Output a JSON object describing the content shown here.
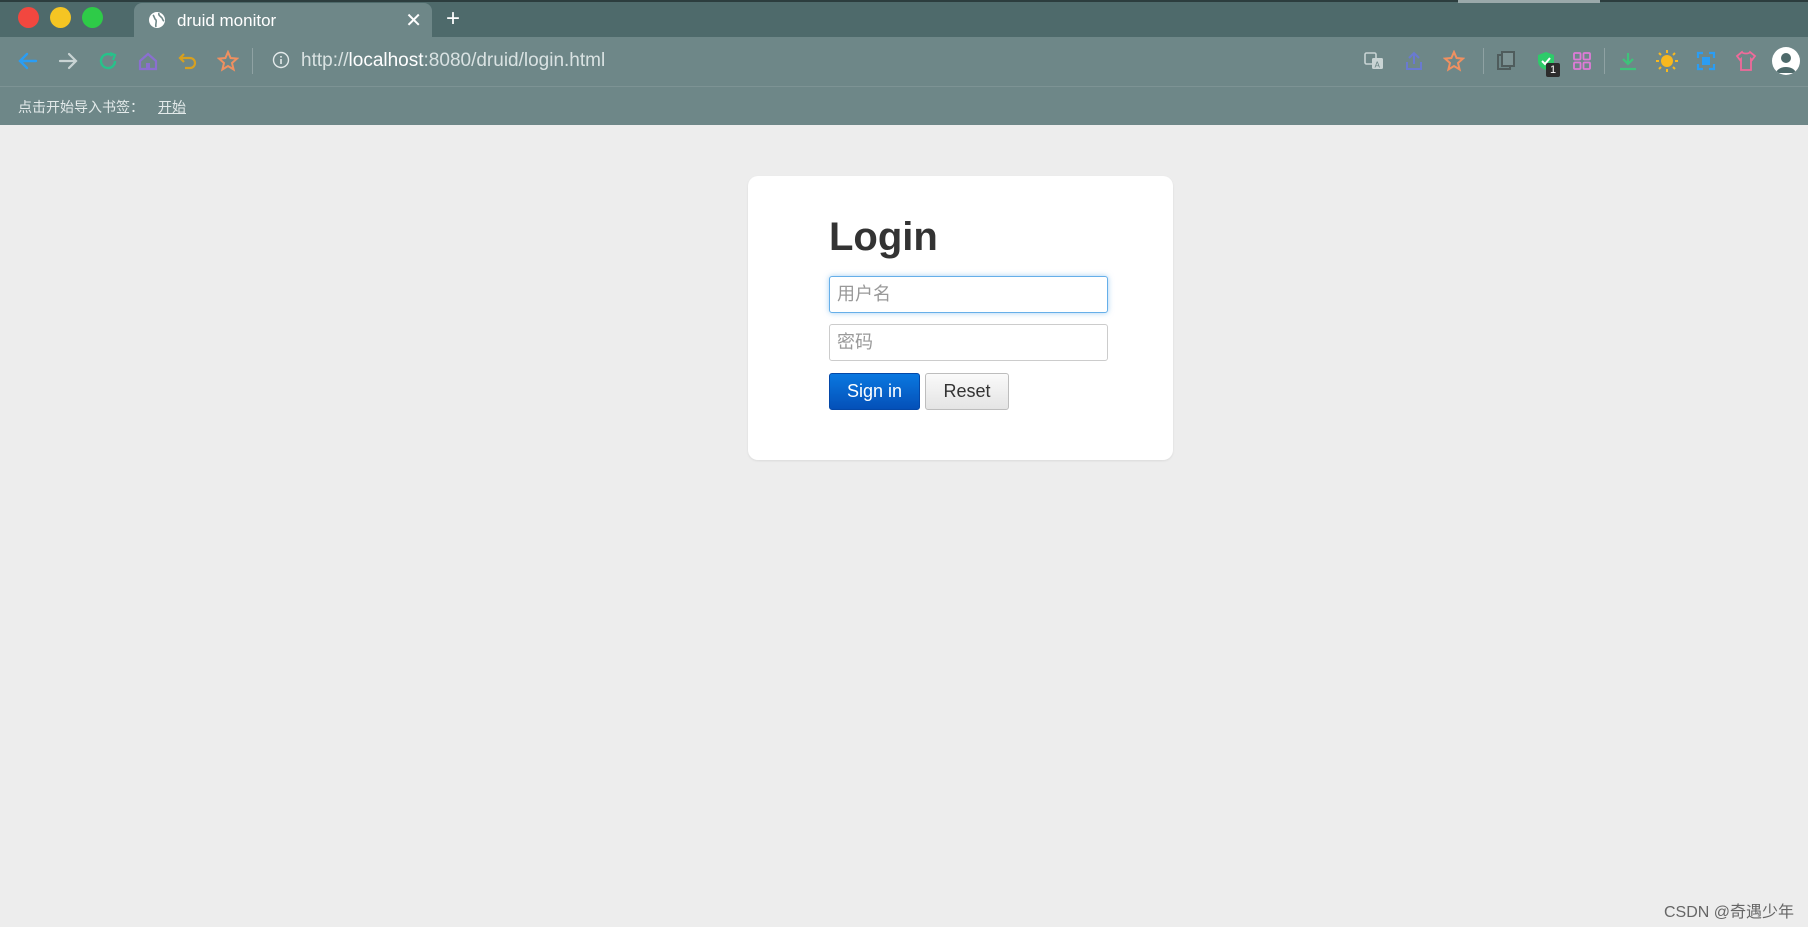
{
  "browser": {
    "tab": {
      "title": "druid monitor",
      "close_glyph": "✕"
    },
    "new_tab_glyph": "+",
    "address": {
      "scheme": "http://",
      "host": "localhost",
      "rest": ":8080/druid/login.html"
    },
    "extension_badge": "1",
    "bookmarks": {
      "prompt": "点击开始导入书签：",
      "start_link": "开始"
    },
    "icons": {
      "back": "back-arrow-icon",
      "forward": "forward-arrow-icon",
      "reload": "reload-icon",
      "home": "home-icon",
      "undo": "undo-icon",
      "favorite": "star-icon",
      "translate": "translate-icon",
      "share": "share-icon",
      "bookmark": "bookmark-star-icon",
      "collections": "collections-icon",
      "shield": "shield-check-icon",
      "apps": "apps-grid-icon",
      "download": "download-icon",
      "theme": "sun-icon",
      "screenshot": "screenshot-icon",
      "skin": "shirt-icon",
      "profile": "avatar-icon"
    },
    "colors": {
      "chrome": "#6e8788",
      "tabstrip": "#4e6a6b"
    }
  },
  "login": {
    "title": "Login",
    "username_placeholder": "用户名",
    "password_placeholder": "密码",
    "signin_label": "Sign in",
    "reset_label": "Reset",
    "colors": {
      "primary": "#0563cc",
      "focus": "#66afe9"
    }
  },
  "watermark": "CSDN @奇遇少年"
}
